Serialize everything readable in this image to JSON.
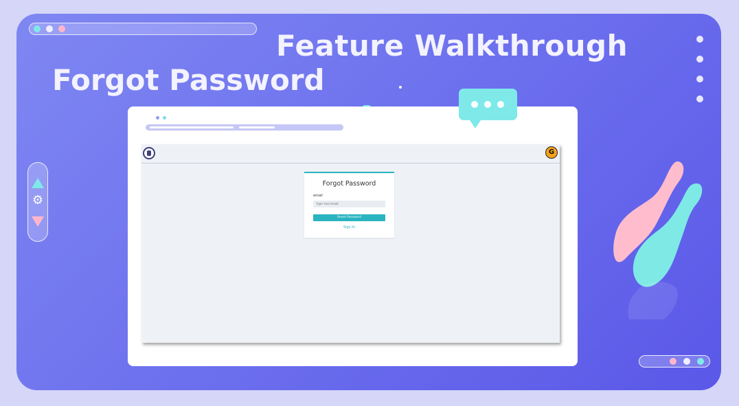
{
  "header": {
    "title": "Feature Walkthrough",
    "subtitle": "Forgot Password"
  },
  "forgot_password_form": {
    "title": "Forgot Password",
    "email_label": "email",
    "email_placeholder": "Type Your Email",
    "email_value": "",
    "submit_label": "Reset Password",
    "signin_link": "Sign In"
  },
  "app_header": {
    "right_logo_letter": "G"
  },
  "icons": {
    "left_logo": "institute-logo-icon",
    "right_logo": "brand-logo-icon",
    "chat_bubble": "chat-bubble-icon",
    "up": "triangle-up-icon",
    "settings": "gear-icon",
    "down": "triangle-down-icon"
  },
  "colors": {
    "background": "#d5d6f8",
    "card_gradient_start": "#7f87f2",
    "card_gradient_end": "#5a58e8",
    "accent_teal": "#2ab3c0",
    "bubble": "#7fe9ea",
    "pink": "#ffb6cb",
    "title_text": "#f3f2ff"
  }
}
